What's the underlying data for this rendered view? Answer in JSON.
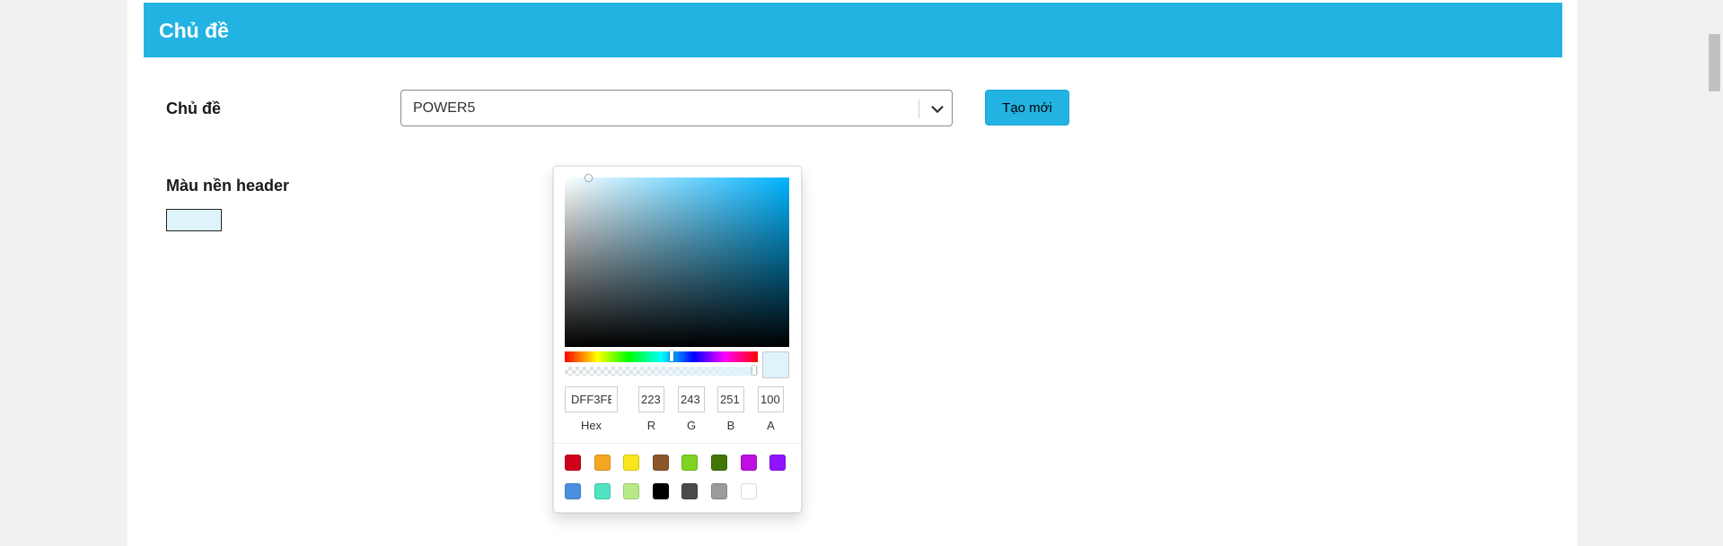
{
  "section": {
    "title": "Chủ đề"
  },
  "theme": {
    "label": "Chủ đề",
    "selected": "POWER5",
    "create_button": "Tạo mới"
  },
  "header_color": {
    "label": "Màu nền header",
    "value_color": "#dff3fb"
  },
  "color_picker": {
    "hex_value": "DFF3FB",
    "r": "223",
    "g": "243",
    "b": "251",
    "a": "100",
    "labels": {
      "hex": "Hex",
      "r": "R",
      "g": "G",
      "b": "B",
      "a": "A"
    },
    "hue_color": "#00b4ff",
    "alpha_fraction": 1.0,
    "presets": [
      "#d0021b",
      "#f5a623",
      "#f8e71c",
      "#8b572a",
      "#7ed321",
      "#417505",
      "#bd10e0",
      "#9013fe",
      "#4a90e2",
      "#50e3c2",
      "#b8e986",
      "#000000",
      "#4a4a4a",
      "#9b9b9b",
      "#ffffff"
    ]
  },
  "colors": {
    "accent": "#22b3e3"
  }
}
